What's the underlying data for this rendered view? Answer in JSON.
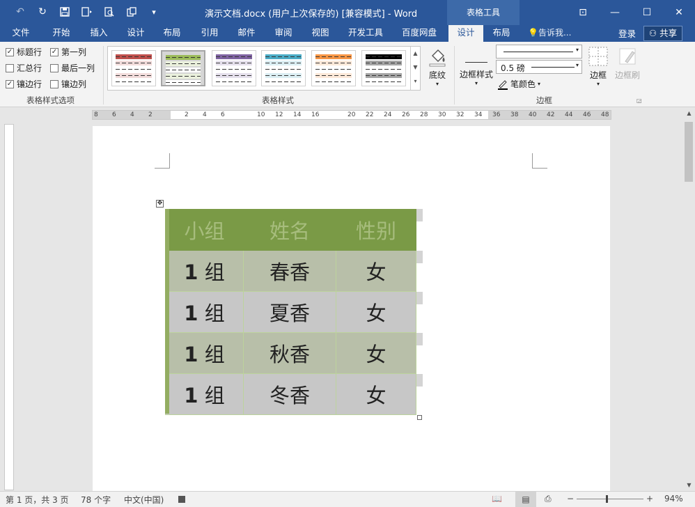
{
  "title_bar": {
    "title": "演示文档.docx (用户上次保存的) [兼容模式] - Word",
    "context_tab": "表格工具",
    "qat": {
      "undo_icon": "↶",
      "redo_icon": "↻",
      "save_icon": "💾",
      "more_icon": "▾"
    },
    "window": {
      "restore_ribbon_icon": "⊡",
      "minimize": "—",
      "maximize": "☐",
      "close": "✕"
    }
  },
  "tabs": [
    {
      "label": "文件"
    },
    {
      "label": "开始"
    },
    {
      "label": "插入"
    },
    {
      "label": "设计"
    },
    {
      "label": "布局"
    },
    {
      "label": "引用"
    },
    {
      "label": "邮件"
    },
    {
      "label": "审阅"
    },
    {
      "label": "视图"
    },
    {
      "label": "开发工具"
    },
    {
      "label": "百度网盘"
    },
    {
      "label": "设计"
    },
    {
      "label": "布局"
    }
  ],
  "tell_me": "告诉我...",
  "login": "登录",
  "share": "共享",
  "ribbon": {
    "options_group": "表格样式选项",
    "styles_group": "表格样式",
    "borders_group": "边框",
    "checkboxes": [
      {
        "label": "标题行",
        "checked": true
      },
      {
        "label": "第一列",
        "checked": true
      },
      {
        "label": "汇总行",
        "checked": false
      },
      {
        "label": "最后一列",
        "checked": false
      },
      {
        "label": "镶边行",
        "checked": true
      },
      {
        "label": "镶边列",
        "checked": false
      }
    ],
    "styles": [
      {
        "head": "#c0504d",
        "band": "#f2dcdb"
      },
      {
        "head": "#9bbb59",
        "band": "#ebf1dd"
      },
      {
        "head": "#8064a2",
        "band": "#e5e0ec"
      },
      {
        "head": "#4bacc6",
        "band": "#dbeef3"
      },
      {
        "head": "#f79646",
        "band": "#fde9d9"
      },
      {
        "head": "#000000",
        "band": "#a5a5a5"
      }
    ],
    "shading": "底纹",
    "border_styles": "边框样式",
    "pen_weight": "0.5 磅",
    "pen_color": "笔颜色",
    "borders": "边框",
    "border_painter": "边框刷"
  },
  "ruler": {
    "ticks": [
      "8",
      "6",
      "4",
      "2",
      "2",
      "4",
      "6",
      "10",
      "12",
      "14",
      "16",
      "20",
      "22",
      "24",
      "26",
      "28",
      "30",
      "32",
      "34",
      "36",
      "38",
      "40",
      "42",
      "44",
      "46",
      "48"
    ]
  },
  "table": {
    "header": [
      "小组",
      "姓名",
      "性别"
    ],
    "rows": [
      {
        "group_num": "1",
        "group_suffix": " 组",
        "name": "春香",
        "gender": "女"
      },
      {
        "group_num": "1",
        "group_suffix": " 组",
        "name": "夏香",
        "gender": "女"
      },
      {
        "group_num": "1",
        "group_suffix": " 组",
        "name": "秋香",
        "gender": "女"
      },
      {
        "group_num": "1",
        "group_suffix": " 组",
        "name": "冬香",
        "gender": "女"
      }
    ]
  },
  "status_bar": {
    "page": "第 1 页，共 3 页",
    "words": "78 个字",
    "language": "中文(中国)",
    "zoom": "94%"
  }
}
